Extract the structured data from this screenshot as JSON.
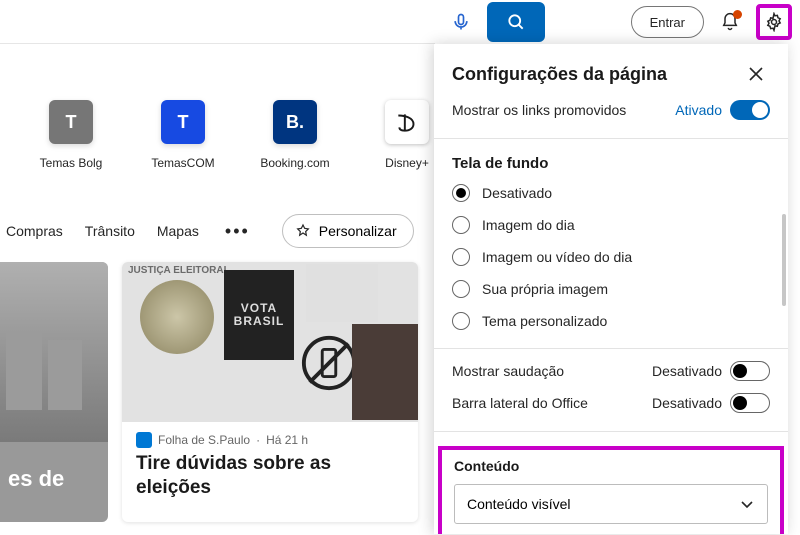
{
  "topbar": {
    "search_placeholder": "",
    "signin_label": "Entrar"
  },
  "tiles": [
    {
      "label": "Temas Bolg",
      "letter": "T",
      "bg": "#767676"
    },
    {
      "label": "TemasCOM",
      "letter": "T",
      "bg": "#174ae2"
    },
    {
      "label": "Booking.com",
      "letter": "B.",
      "bg": "#003580"
    },
    {
      "label": "Disney+",
      "letter": "D",
      "bg": "#ffffff"
    }
  ],
  "nav": {
    "items": [
      "Compras",
      "Trânsito",
      "Mapas"
    ],
    "personalize_label": "Personalizar"
  },
  "cards": {
    "card1_title": "es de",
    "card2": {
      "source": "Folha de S.Paulo",
      "time": "Há 21 h",
      "title": "Tire dúvidas sobre as eleições",
      "poster_line1": "VOTA",
      "poster_line2": "BRASIL",
      "banner_text": "JUSTIÇA ELEITORAL"
    }
  },
  "panel": {
    "title": "Configurações da página",
    "promoted": {
      "label": "Mostrar os links promovidos",
      "status": "Ativado"
    },
    "background": {
      "title": "Tela de fundo",
      "options": [
        "Desativado",
        "Imagem do dia",
        "Imagem ou vídeo do dia",
        "Sua própria imagem",
        "Tema personalizado"
      ],
      "selected_index": 0
    },
    "greeting": {
      "label": "Mostrar saudação",
      "status": "Desativado"
    },
    "office_bar": {
      "label": "Barra lateral do Office",
      "status": "Desativado"
    },
    "content": {
      "title": "Conteúdo",
      "select_value": "Conteúdo visível"
    }
  }
}
